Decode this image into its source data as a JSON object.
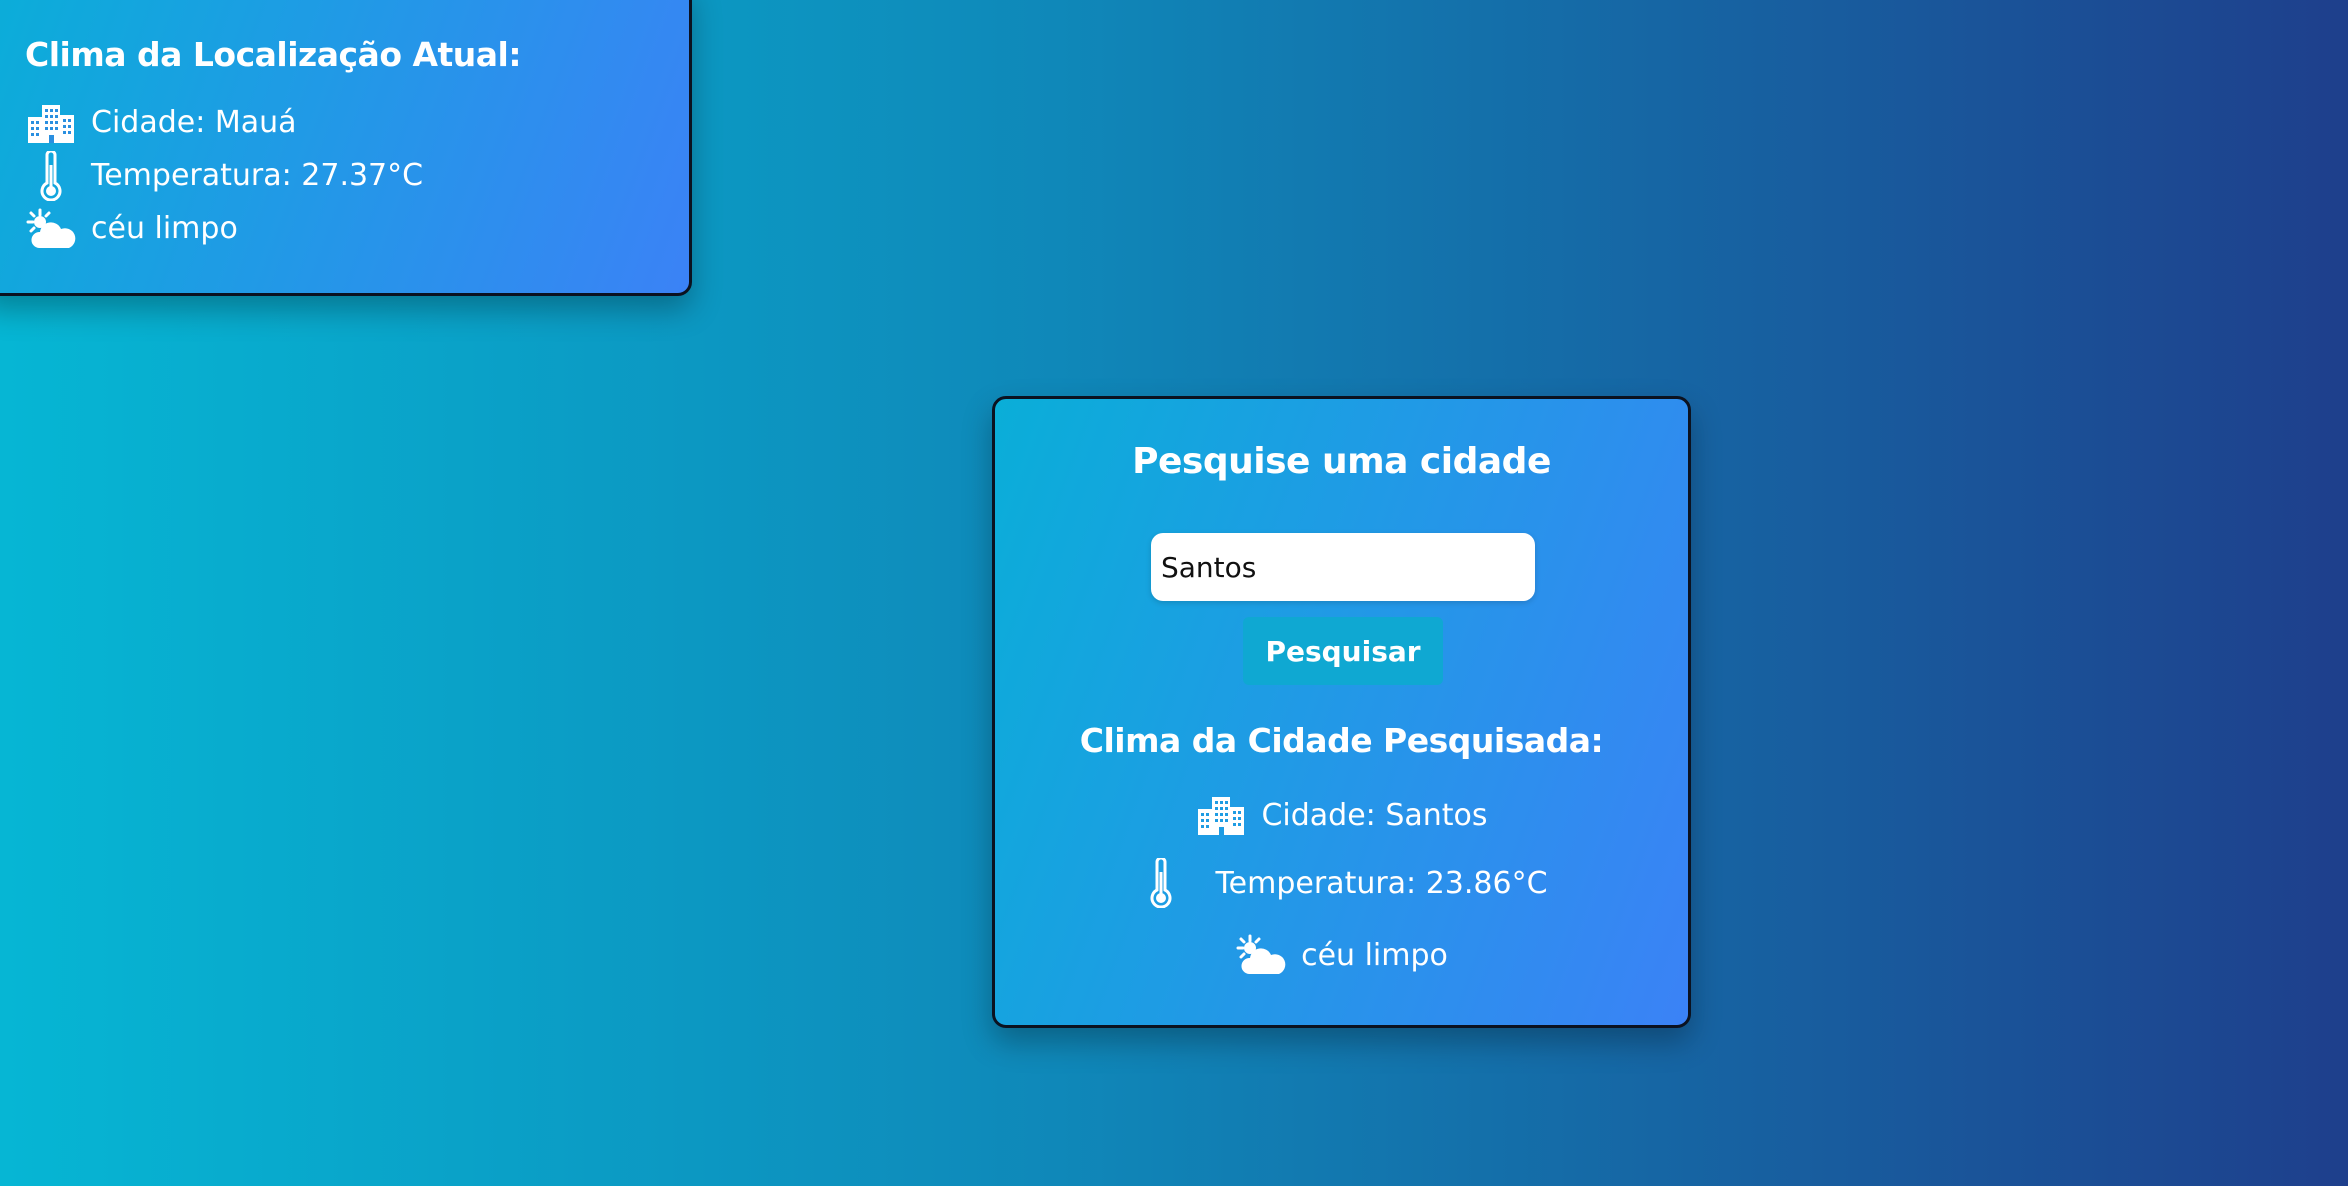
{
  "current": {
    "title": "Clima da Localização Atual:",
    "city": "Cidade: Mauá",
    "temperature": "Temperatura: 27.37°C",
    "description": "céu limpo"
  },
  "search": {
    "heading": "Pesquise uma cidade",
    "input_value": "Santos",
    "button_label": "Pesquisar",
    "result_title": "Clima da Cidade Pesquisada:",
    "city": "Cidade: Santos",
    "temperature": "Temperatura: 23.86°C",
    "description": "céu limpo"
  },
  "icons": {
    "city": "city-icon",
    "temperature": "thermometer-icon",
    "weather": "sun-cloud-icon"
  },
  "colors": {
    "background_start": "#06b6d4",
    "background_end": "#1e3f8c",
    "card_start": "#0aaed8",
    "card_end": "#3b82f6",
    "button": "#0fa8d2",
    "text": "#ffffff"
  }
}
